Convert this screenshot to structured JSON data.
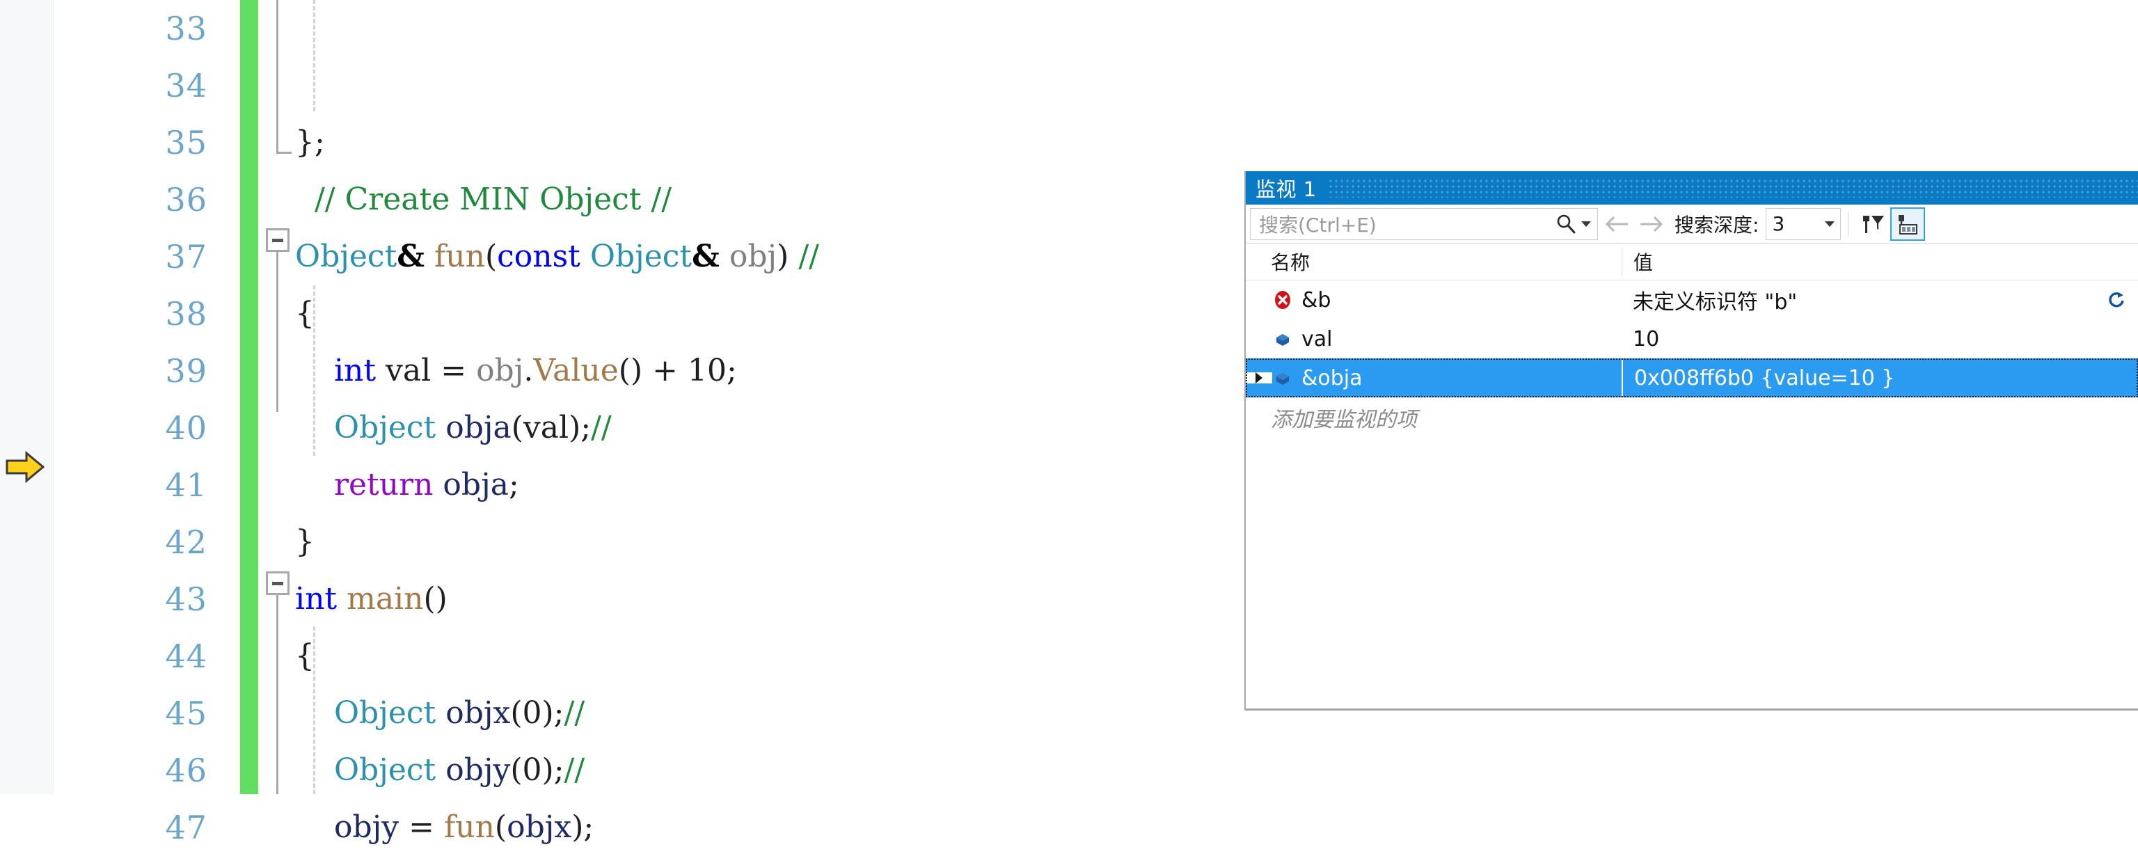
{
  "editor": {
    "lines": [
      {
        "num": "33",
        "tokens": []
      },
      {
        "num": "34",
        "tokens": []
      },
      {
        "num": "35",
        "tokens": [
          {
            "t": "};",
            "c": "t-plain"
          }
        ]
      },
      {
        "num": "36",
        "tokens": [
          {
            "t": "  // Create MIN Object //",
            "c": "t-cmt"
          }
        ]
      },
      {
        "num": "37",
        "tokens": [
          {
            "t": "Object",
            "c": "t-type"
          },
          {
            "t": "&",
            "c": "t-amp"
          },
          {
            "t": " ",
            "c": "t-plain"
          },
          {
            "t": "fun",
            "c": "t-fn"
          },
          {
            "t": "(",
            "c": "t-plain"
          },
          {
            "t": "const",
            "c": "t-kw"
          },
          {
            "t": " ",
            "c": "t-plain"
          },
          {
            "t": "Object",
            "c": "t-type"
          },
          {
            "t": "&",
            "c": "t-amp"
          },
          {
            "t": " ",
            "c": "t-plain"
          },
          {
            "t": "obj",
            "c": "t-obj"
          },
          {
            "t": ")",
            "c": "t-plain"
          },
          {
            "t": " ",
            "c": "t-plain"
          },
          {
            "t": "//",
            "c": "t-cmt"
          }
        ]
      },
      {
        "num": "38",
        "tokens": [
          {
            "t": "{",
            "c": "t-plain"
          }
        ]
      },
      {
        "num": "39",
        "tokens": [
          {
            "t": "    ",
            "c": "t-plain"
          },
          {
            "t": "int",
            "c": "t-kw"
          },
          {
            "t": " ",
            "c": "t-plain"
          },
          {
            "t": "val",
            "c": "t-plain"
          },
          {
            "t": " = ",
            "c": "t-plain"
          },
          {
            "t": "obj",
            "c": "t-obj"
          },
          {
            "t": ".",
            "c": "t-plain"
          },
          {
            "t": "Value",
            "c": "t-fn"
          },
          {
            "t": "() + ",
            "c": "t-plain"
          },
          {
            "t": "10",
            "c": "t-num"
          },
          {
            "t": ";",
            "c": "t-plain"
          }
        ]
      },
      {
        "num": "40",
        "tokens": [
          {
            "t": "    ",
            "c": "t-plain"
          },
          {
            "t": "Object",
            "c": "t-type"
          },
          {
            "t": " ",
            "c": "t-plain"
          },
          {
            "t": "obja",
            "c": "t-var"
          },
          {
            "t": "(",
            "c": "t-plain"
          },
          {
            "t": "val",
            "c": "t-plain"
          },
          {
            "t": ");",
            "c": "t-plain"
          },
          {
            "t": "//",
            "c": "t-cmt"
          }
        ]
      },
      {
        "num": "41",
        "tokens": [
          {
            "t": "    ",
            "c": "t-plain"
          },
          {
            "t": "return",
            "c": "t-kw2"
          },
          {
            "t": " ",
            "c": "t-plain"
          },
          {
            "t": "obja",
            "c": "t-var"
          },
          {
            "t": ";",
            "c": "t-plain"
          }
        ]
      },
      {
        "num": "42",
        "tokens": [
          {
            "t": "}",
            "c": "t-plain"
          }
        ]
      },
      {
        "num": "43",
        "tokens": [
          {
            "t": "int",
            "c": "t-kw"
          },
          {
            "t": " ",
            "c": "t-plain"
          },
          {
            "t": "main",
            "c": "t-fn"
          },
          {
            "t": "()",
            "c": "t-plain"
          }
        ]
      },
      {
        "num": "44",
        "tokens": [
          {
            "t": "{",
            "c": "t-plain"
          }
        ]
      },
      {
        "num": "45",
        "tokens": [
          {
            "t": "    ",
            "c": "t-plain"
          },
          {
            "t": "Object",
            "c": "t-type"
          },
          {
            "t": " ",
            "c": "t-plain"
          },
          {
            "t": "objx",
            "c": "t-var"
          },
          {
            "t": "(",
            "c": "t-plain"
          },
          {
            "t": "0",
            "c": "t-num"
          },
          {
            "t": ");",
            "c": "t-plain"
          },
          {
            "t": "//",
            "c": "t-cmt"
          }
        ]
      },
      {
        "num": "46",
        "tokens": [
          {
            "t": "    ",
            "c": "t-plain"
          },
          {
            "t": "Object",
            "c": "t-type"
          },
          {
            "t": " ",
            "c": "t-plain"
          },
          {
            "t": "objy",
            "c": "t-var"
          },
          {
            "t": "(",
            "c": "t-plain"
          },
          {
            "t": "0",
            "c": "t-num"
          },
          {
            "t": ");",
            "c": "t-plain"
          },
          {
            "t": "//",
            "c": "t-cmt"
          }
        ]
      },
      {
        "num": "47",
        "tokens": [
          {
            "t": "    ",
            "c": "t-plain"
          },
          {
            "t": "objy",
            "c": "t-var"
          },
          {
            "t": " = ",
            "c": "t-plain"
          },
          {
            "t": "fun",
            "c": "t-fn"
          },
          {
            "t": "(",
            "c": "t-plain"
          },
          {
            "t": "objx",
            "c": "t-var"
          },
          {
            "t": ");",
            "c": "t-plain"
          }
        ]
      }
    ],
    "current_statement_line": "41",
    "change_bar_color": "#61df61",
    "arrow_color": "#ffd11a"
  },
  "watch": {
    "title": "监视 1",
    "search": {
      "placeholder": "搜索(Ctrl+E)",
      "value": ""
    },
    "depth": {
      "label": "搜索深度:",
      "value": "3"
    },
    "columns": {
      "name": "名称",
      "value": "值"
    },
    "rows": [
      {
        "name": "&b",
        "value": "未定义标识符 \"b\"",
        "icon": "error-icon",
        "expandable": false,
        "selected": false,
        "refresh": true
      },
      {
        "name": "val",
        "value": "10",
        "icon": "variable-icon",
        "expandable": false,
        "selected": false,
        "refresh": false
      },
      {
        "name": "&obja",
        "value": "0x008ff6b0 {value=10 }",
        "icon": "variable-icon",
        "expandable": true,
        "selected": true,
        "refresh": false
      }
    ],
    "add_watch_placeholder": "添加要监视的项",
    "accent_color": "#0a7ac4",
    "selection_color": "#2a9bf0",
    "error_color": "#d3121a"
  }
}
